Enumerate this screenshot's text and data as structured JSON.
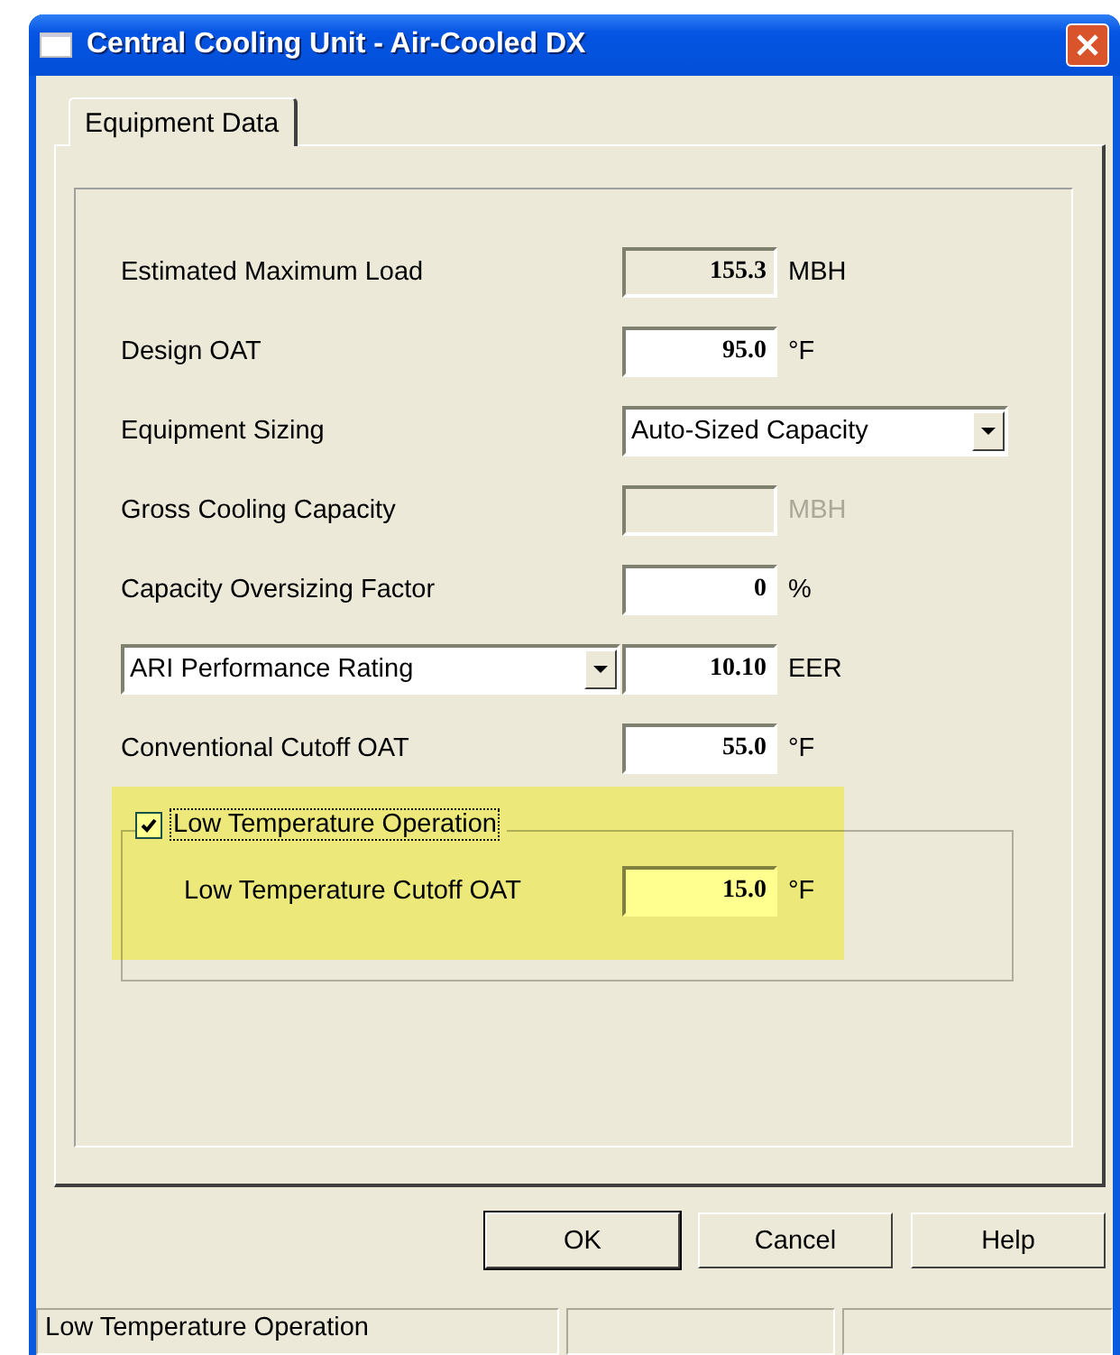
{
  "window": {
    "title": "Central Cooling Unit - Air-Cooled DX"
  },
  "tabs": [
    {
      "label": "Equipment Data",
      "selected": true
    }
  ],
  "rows": [
    {
      "kind": "field",
      "label": "Estimated Maximum Load",
      "value": "155.3",
      "unit": "MBH",
      "readonly": true,
      "disabled": false
    },
    {
      "kind": "field",
      "label": "Design OAT",
      "value": "95.0",
      "unit": "°F",
      "readonly": false,
      "disabled": false
    },
    {
      "kind": "dropdown",
      "label": "Equipment Sizing",
      "value": "Auto-Sized Capacity"
    },
    {
      "kind": "field",
      "label": "Gross Cooling Capacity",
      "unit": "MBH",
      "readonly": false,
      "disabled": true
    },
    {
      "kind": "field",
      "label": "Capacity Oversizing Factor",
      "value": "0",
      "unit": "%",
      "readonly": false,
      "disabled": false
    },
    {
      "kind": "select_field",
      "select": "ARI Performance Rating",
      "value": "10.10",
      "unit": "EER",
      "readonly": false,
      "disabled": false
    },
    {
      "kind": "field",
      "label": "Conventional Cutoff OAT",
      "value": "55.0",
      "unit": "°F",
      "readonly": false,
      "disabled": false
    }
  ],
  "low_temperature": {
    "label": "Low Temperature Operation",
    "checked": true,
    "focused": true,
    "highlighted": true,
    "field": {
      "label": "Low Temperature Cutoff OAT",
      "value": "15.0",
      "unit": "°F"
    }
  },
  "buttons": [
    {
      "label": "OK",
      "default": true
    },
    {
      "label": "Cancel",
      "default": false
    },
    {
      "label": "Help",
      "default": false
    }
  ],
  "status_bar": [
    "Low Temperature Operation"
  ]
}
